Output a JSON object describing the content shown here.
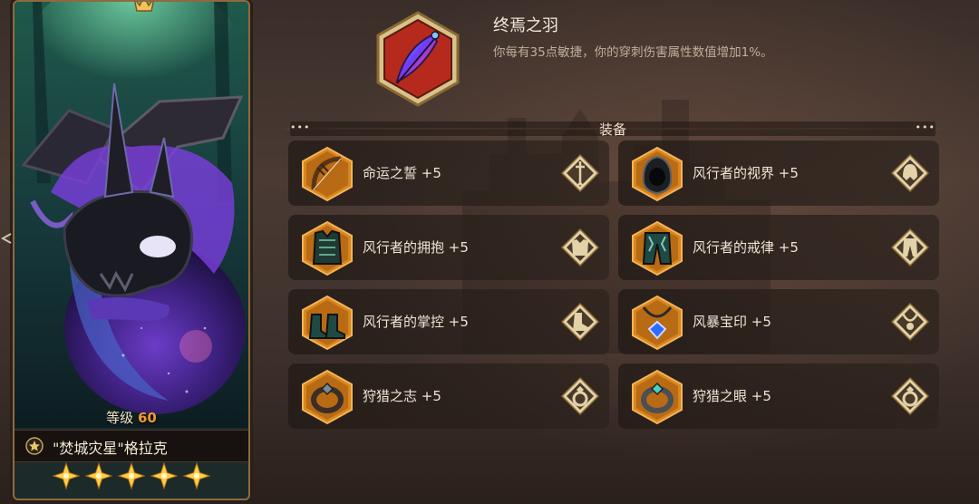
{
  "hero": {
    "level_label": "等级",
    "level_value": "60",
    "name": "\"焚城灾星\"格拉克",
    "star_count": 5
  },
  "skill": {
    "title": "终焉之羽",
    "description": "你每有35点敏捷，你的穿刺伤害属性数值增加1%。",
    "icon": "feather-icon"
  },
  "equipment": {
    "section_title": "装备",
    "slots": [
      {
        "name": "命运之誓 +5",
        "item_icon": "bow-icon",
        "type_icon": "weapon-slot-icon"
      },
      {
        "name": "风行者的视界 +5",
        "item_icon": "hood-icon",
        "type_icon": "helmet-slot-icon"
      },
      {
        "name": "风行者的拥抱 +5",
        "item_icon": "chest-armor-icon",
        "type_icon": "armor-slot-icon"
      },
      {
        "name": "风行者的戒律 +5",
        "item_icon": "leggings-icon",
        "type_icon": "pants-slot-icon"
      },
      {
        "name": "风行者的掌控 +5",
        "item_icon": "boots-icon",
        "type_icon": "boots-slot-icon"
      },
      {
        "name": "风暴宝印 +5",
        "item_icon": "amulet-icon",
        "type_icon": "necklace-slot-icon"
      },
      {
        "name": "狩猎之志 +5",
        "item_icon": "ring-icon",
        "type_icon": "ring-slot-icon"
      },
      {
        "name": "狩猎之眼 +5",
        "item_icon": "ring-icon",
        "type_icon": "ring-slot-icon"
      }
    ]
  },
  "colors": {
    "accent_orange": "#d8861e",
    "gold_frame": "#c9a45c",
    "level_orange": "#f39a2d"
  }
}
